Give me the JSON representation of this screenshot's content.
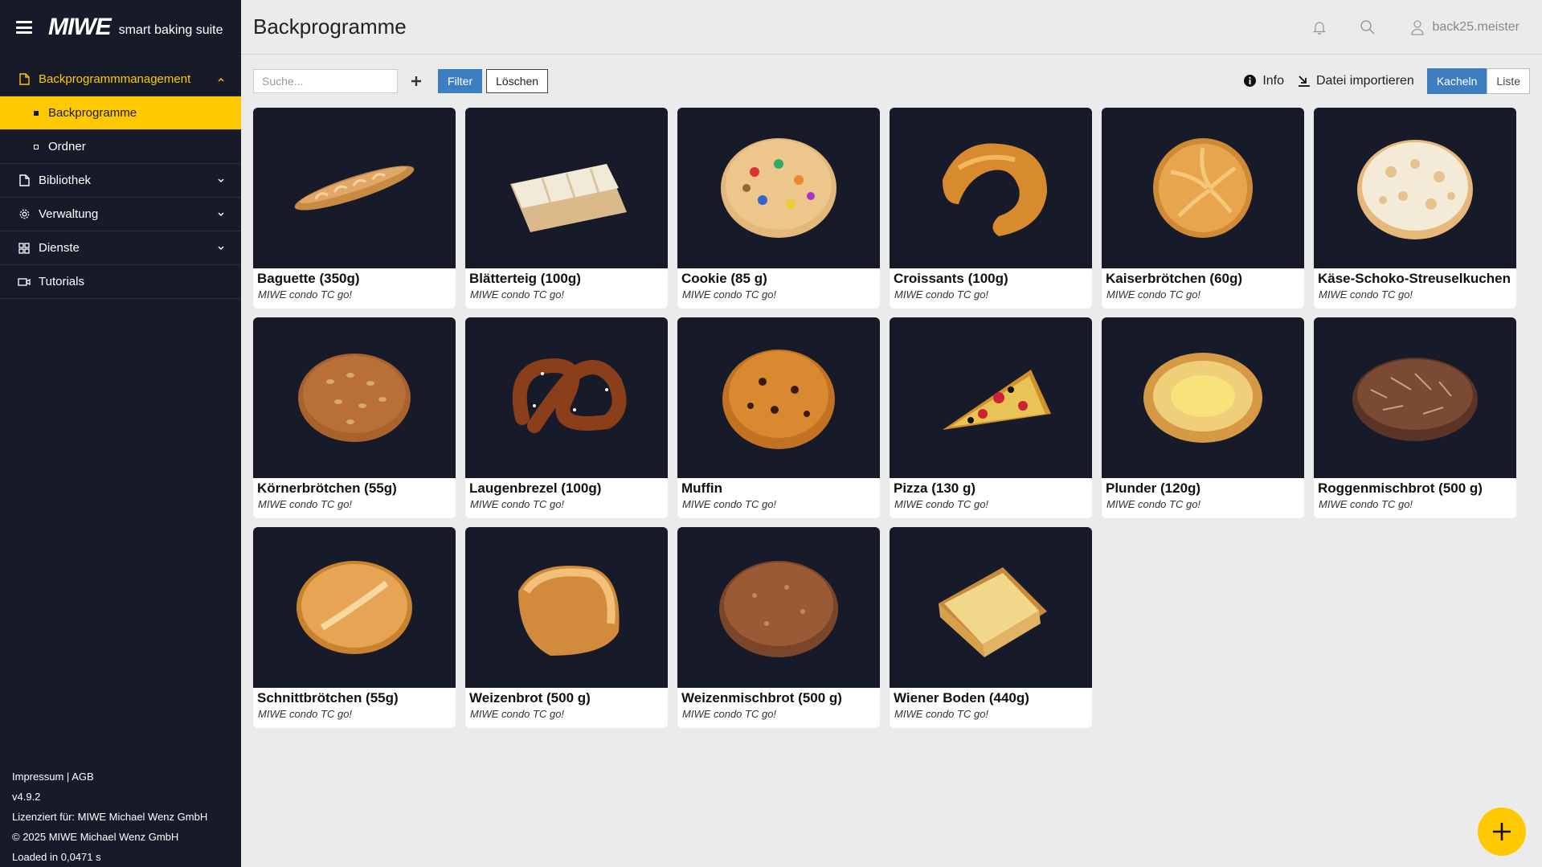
{
  "brand": {
    "logo": "MIWE",
    "tagline": "smart baking suite"
  },
  "sidebar": {
    "items": [
      {
        "label": "Backprogrammmanagement",
        "icon": "file-icon",
        "open": true
      },
      {
        "label": "Bibliothek",
        "icon": "file-icon"
      },
      {
        "label": "Verwaltung",
        "icon": "gear-icon"
      },
      {
        "label": "Dienste",
        "icon": "grid-icon"
      },
      {
        "label": "Tutorials",
        "icon": "video-icon"
      }
    ],
    "subitems": [
      {
        "label": "Backprogramme",
        "active": true
      },
      {
        "label": "Ordner"
      }
    ],
    "footer": {
      "impressum": "Impressum",
      "sep": " | ",
      "agb": "AGB",
      "version": "v4.9.2",
      "license": "Lizenziert für: MIWE Michael Wenz GmbH",
      "copyright": "© 2025 MIWE Michael Wenz GmbH",
      "loaded": "Loaded in 0,0471 s"
    }
  },
  "header": {
    "title": "Backprogramme",
    "user": "back25.meister"
  },
  "toolbar": {
    "search_placeholder": "Suche...",
    "filter_label": "Filter",
    "clear_label": "Löschen",
    "info_label": "Info",
    "import_label": "Datei importieren",
    "view_tiles": "Kacheln",
    "view_list": "Liste",
    "active_view": "Kacheln"
  },
  "programs": [
    {
      "name": "Baguette (350g)",
      "device": "MIWE condo TC go!",
      "shape": "baguette"
    },
    {
      "name": "Blätterteig (100g)",
      "device": "MIWE condo TC go!",
      "shape": "pastry"
    },
    {
      "name": "Cookie (85 g)",
      "device": "MIWE condo TC go!",
      "shape": "cookie"
    },
    {
      "name": "Croissants (100g)",
      "device": "MIWE condo TC go!",
      "shape": "croissant"
    },
    {
      "name": "Kaiserbrötchen (60g)",
      "device": "MIWE condo TC go!",
      "shape": "roll"
    },
    {
      "name": "Käse-Schoko-Streuselkuchen",
      "device": "MIWE condo TC go!",
      "shape": "crumble"
    },
    {
      "name": "Körnerbrötchen (55g)",
      "device": "MIWE condo TC go!",
      "shape": "seeded"
    },
    {
      "name": "Laugenbrezel (100g)",
      "device": "MIWE condo TC go!",
      "shape": "pretzel"
    },
    {
      "name": "Muffin",
      "device": "MIWE condo TC go!",
      "shape": "muffin"
    },
    {
      "name": "Pizza (130 g)",
      "device": "MIWE condo TC go!",
      "shape": "pizza"
    },
    {
      "name": "Plunder (120g)",
      "device": "MIWE condo TC go!",
      "shape": "danish"
    },
    {
      "name": "Roggenmischbrot (500 g)",
      "device": "MIWE condo TC go!",
      "shape": "rye"
    },
    {
      "name": "Schnittbrötchen (55g)",
      "device": "MIWE condo TC go!",
      "shape": "splitroll"
    },
    {
      "name": "Weizenbrot (500 g)",
      "device": "MIWE condo TC go!",
      "shape": "loaf"
    },
    {
      "name": "Weizenmischbrot (500 g)",
      "device": "MIWE condo TC go!",
      "shape": "mixedloaf"
    },
    {
      "name": "Wiener Boden (440g)",
      "device": "MIWE condo TC go!",
      "shape": "cake"
    }
  ],
  "colors": {
    "accent": "#ffc800",
    "sidebar": "#171b29",
    "primary": "#3d7ec1",
    "tile_bg": "#171b29"
  }
}
